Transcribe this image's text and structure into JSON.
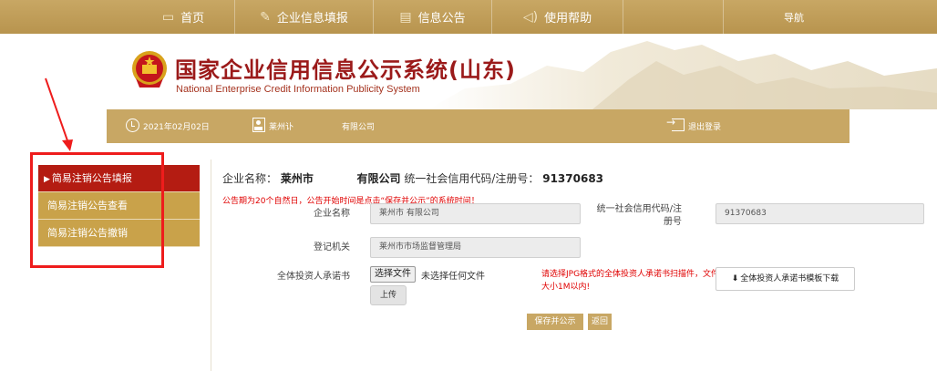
{
  "nav": {
    "home": "首页",
    "fill": "企业信息填报",
    "notice": "信息公告",
    "help": "使用帮助",
    "guide": "导航"
  },
  "banner": {
    "title_cn": "国家企业信用信息公示系统(山东)",
    "title_en": "National Enterprise Credit Information Publicity System"
  },
  "infobar": {
    "date": "2021年02月02日",
    "city": "莱州讣",
    "company": "有限公司",
    "logout": "退出登录"
  },
  "sidebar": {
    "items": [
      {
        "label": "简易注销公告填报",
        "active": true,
        "marker": "▶"
      },
      {
        "label": "简易注销公告查看",
        "active": false
      },
      {
        "label": "简易注销公告撤销",
        "active": false
      }
    ]
  },
  "main": {
    "company_label": "企业名称：",
    "company_city": "莱州市",
    "company_suffix": "有限公司",
    "credit_label": "统一社会信用代码/注册号：",
    "credit_code": "91370683",
    "warning": "公告期为20个自然日，公告开始时间是点击“保存并公示”的系统时间！",
    "fields": {
      "name_label": "企业名称",
      "name_value": "莱州市                    有限公司",
      "code_label_1": "统一社会信用代码/注",
      "code_label_2": "册号",
      "code_value": "91370683",
      "authority_label": "登记机关",
      "authority_value": "莱州市市场监督管理局",
      "commitment_label": "全体投资人承诺书"
    },
    "file_button": "选择文件",
    "file_none": "未选择任何文件",
    "upload": "上传",
    "upload_hint": "请选择JPG格式的全体投资人承诺书扫描件，文件大小1M以内!",
    "template_download": "全体投资人承诺书模板下载",
    "save_publish": "保存并公示",
    "back": "返回"
  },
  "colors": {
    "gold": "#c8a764",
    "active_red": "#b41c12",
    "title_red": "#9b1a1a",
    "annotation_red": "#ee1c1c"
  },
  "icons": [
    "monitor-icon",
    "edit-icon",
    "document-icon",
    "speaker-icon",
    "clock-icon",
    "user-card-icon",
    "logout-icon",
    "download-icon",
    "national-emblem-icon"
  ]
}
